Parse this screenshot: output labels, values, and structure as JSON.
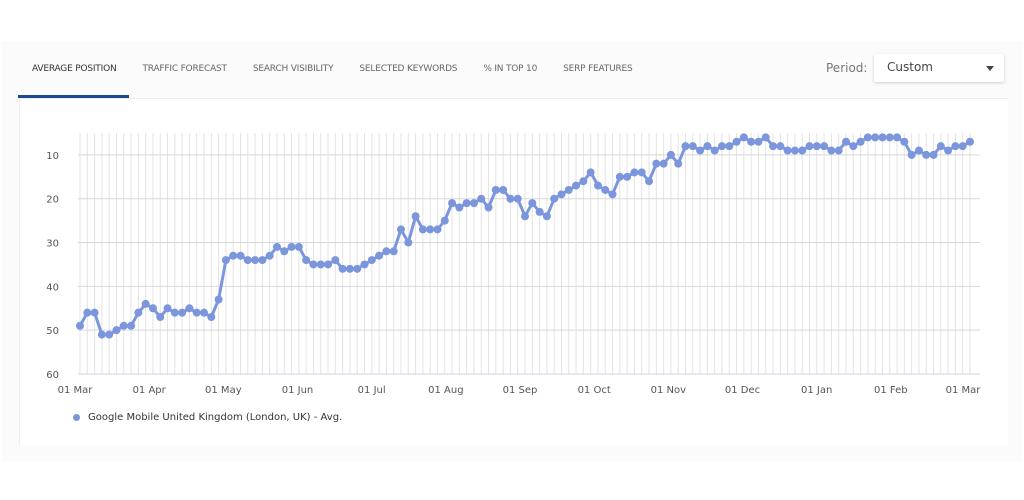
{
  "tabs": [
    {
      "label": "AVERAGE POSITION",
      "active": true
    },
    {
      "label": "TRAFFIC FORECAST",
      "active": false
    },
    {
      "label": "SEARCH VISIBILITY",
      "active": false
    },
    {
      "label": "SELECTED KEYWORDS",
      "active": false
    },
    {
      "label": "% IN TOP 10",
      "active": false
    },
    {
      "label": "SERP FEATURES",
      "active": false
    }
  ],
  "period": {
    "label": "Period:",
    "value": "Custom"
  },
  "colors": {
    "series": "#7b96dc",
    "active_tab": "#1e4b8f"
  },
  "chart_data": {
    "type": "line",
    "title": "",
    "xlabel": "",
    "ylabel": "",
    "ylim": [
      60,
      5
    ],
    "y_inverted": true,
    "yticks": [
      10,
      20,
      30,
      40,
      50,
      60
    ],
    "xtick_labels": [
      "01 Mar",
      "01 Apr",
      "01 May",
      "01 Jun",
      "01 Jul",
      "01 Aug",
      "01 Sep",
      "01 Oct",
      "01 Nov",
      "01 Dec",
      "01 Jan",
      "01 Feb",
      "01 Mar"
    ],
    "grid": true,
    "legend_position": "bottom-left",
    "series": [
      {
        "name": "Google Mobile United Kingdom (London, UK) - Avg.",
        "values": [
          49,
          46,
          46,
          51,
          51,
          50,
          49,
          49,
          46,
          44,
          45,
          47,
          45,
          46,
          46,
          45,
          46,
          46,
          47,
          43,
          34,
          33,
          33,
          34,
          34,
          34,
          33,
          31,
          32,
          31,
          31,
          34,
          35,
          35,
          35,
          34,
          36,
          36,
          36,
          35,
          34,
          33,
          32,
          32,
          27,
          30,
          24,
          27,
          27,
          27,
          25,
          21,
          22,
          21,
          21,
          20,
          22,
          18,
          18,
          20,
          20,
          24,
          21,
          23,
          24,
          20,
          19,
          18,
          17,
          16,
          14,
          17,
          18,
          19,
          15,
          15,
          14,
          14,
          16,
          12,
          12,
          10,
          12,
          8,
          8,
          9,
          8,
          9,
          8,
          8,
          7,
          6,
          7,
          7,
          6,
          8,
          8,
          9,
          9,
          9,
          8,
          8,
          8,
          9,
          9,
          7,
          8,
          7,
          6,
          6,
          6,
          6,
          6,
          7,
          10,
          9,
          10,
          10,
          8,
          9,
          8,
          8,
          7
        ]
      }
    ]
  }
}
